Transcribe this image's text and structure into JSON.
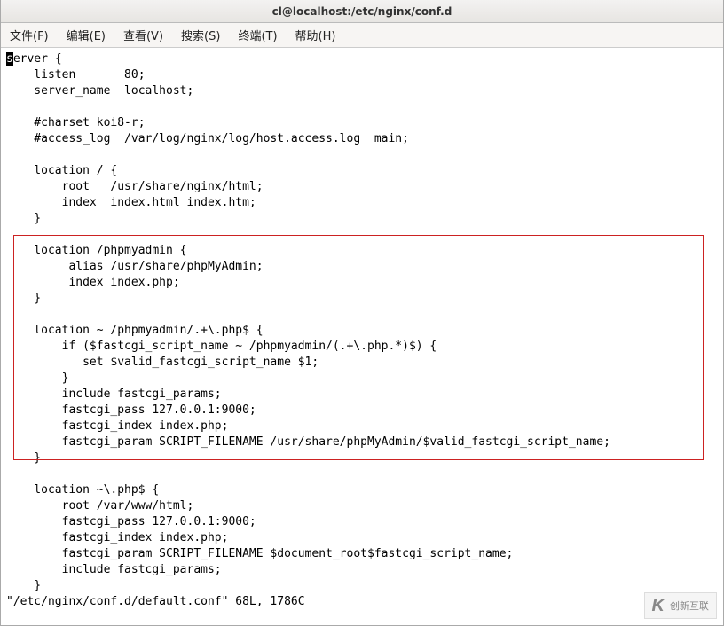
{
  "titlebar": {
    "title": "cl@localhost:/etc/nginx/conf.d"
  },
  "menubar": {
    "file": "文件(F)",
    "edit": "编辑(E)",
    "view": "查看(V)",
    "search": "搜索(S)",
    "term": "终端(T)",
    "help": "帮助(H)"
  },
  "t": {
    "c0": "s",
    "l00": "erver {",
    "l01": "    listen       80;",
    "l02": "    server_name  localhost;",
    "l03": "",
    "l04": "    #charset koi8-r;",
    "l05": "    #access_log  /var/log/nginx/log/host.access.log  main;",
    "l06": "",
    "l07": "    location / {",
    "l08": "        root   /usr/share/nginx/html;",
    "l09": "        index  index.html index.htm;",
    "l10": "    }",
    "l11": "",
    "l12": "    location /phpmyadmin {",
    "l13": "         alias /usr/share/phpMyAdmin;",
    "l14": "         index index.php;",
    "l15": "    }",
    "l16": "",
    "l17": "    location ~ /phpmyadmin/.+\\.php$ {",
    "l18": "        if ($fastcgi_script_name ~ /phpmyadmin/(.+\\.php.*)$) {",
    "l19": "           set $valid_fastcgi_script_name $1;",
    "l20": "        }",
    "l21": "        include fastcgi_params;",
    "l22": "        fastcgi_pass 127.0.0.1:9000;",
    "l23": "        fastcgi_index index.php;",
    "l24": "        fastcgi_param SCRIPT_FILENAME /usr/share/phpMyAdmin/$valid_fastcgi_script_name;",
    "l25": "    }",
    "l26": "",
    "l27": "    location ~\\.php$ {",
    "l28": "        root /var/www/html;",
    "l29": "        fastcgi_pass 127.0.0.1:9000;",
    "l30": "        fastcgi_index index.php;",
    "l31": "        fastcgi_param SCRIPT_FILENAME $document_root$fastcgi_script_name;",
    "l32": "        include fastcgi_params;",
    "l33": "    }",
    "status": "\"/etc/nginx/conf.d/default.conf\" 68L, 1786C"
  },
  "watermark": {
    "label": "创新互联",
    "k": "K"
  }
}
